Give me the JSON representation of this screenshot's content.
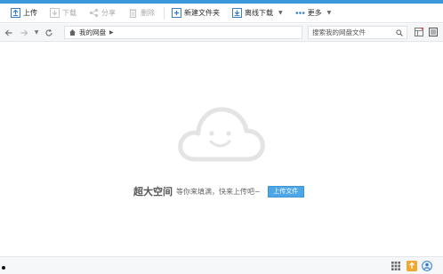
{
  "toolbar": {
    "upload": "上传",
    "download": "下载",
    "share": "分享",
    "delete": "删除",
    "new_folder": "新建文件夹",
    "offline_download": "离线下载",
    "more": "更多"
  },
  "navbar": {
    "path_label": "我的网盘",
    "search_placeholder": "搜索我的网盘文件"
  },
  "empty_state": {
    "title": "超大空间",
    "subtitle": "等你来填满，快来上传吧~",
    "button_label": "上传文件"
  },
  "colors": {
    "accent": "#3c96dc",
    "button": "#4da6e6",
    "cloud": "#e6e6e6"
  }
}
